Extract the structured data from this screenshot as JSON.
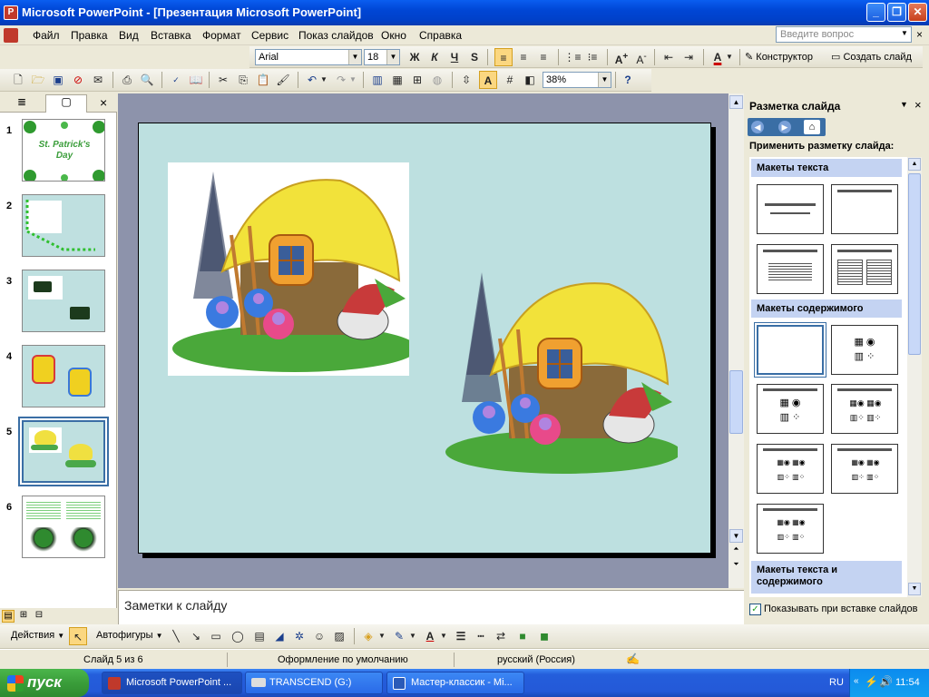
{
  "window": {
    "title": "Microsoft PowerPoint - [Презентация Microsoft PowerPoint]",
    "buttons": [
      "_",
      "❐",
      "✕"
    ]
  },
  "menu": {
    "items": [
      "Файл",
      "Правка",
      "Вид",
      "Вставка",
      "Формат",
      "Сервис",
      "Показ слайдов",
      "Окно",
      "Справка"
    ],
    "help_placeholder": "Введите вопрос"
  },
  "format_toolbar": {
    "font": "Arial",
    "size": "18",
    "bold": "Ж",
    "italic": "К",
    "underline": "Ч",
    "shadow": "S",
    "designer": "Конструктор",
    "new_slide": "Создать слайд"
  },
  "standard_toolbar": {
    "zoom": "38%"
  },
  "slides": {
    "numbers": [
      "1",
      "2",
      "3",
      "4",
      "5",
      "6"
    ],
    "active": "5",
    "thumb1_title": "St. Patrick's Day"
  },
  "notes": {
    "placeholder": "Заметки к слайду"
  },
  "task_pane": {
    "title": "Разметка слайда",
    "apply_label": "Применить разметку слайда:",
    "groups": [
      "Макеты текста",
      "Макеты содержимого",
      "Макеты текста и содержимого"
    ],
    "show_on_insert": "Показывать при вставке слайдов"
  },
  "draw_toolbar": {
    "actions": "Действия",
    "autoshapes": "Автофигуры"
  },
  "status": {
    "slide": "Слайд 5 из 6",
    "design": "Оформление по умолчанию",
    "language": "русский (Россия)"
  },
  "taskbar": {
    "start": "пуск",
    "items": [
      "Microsoft PowerPoint ...",
      "TRANSCEND (G:)",
      "Мастер-классик - Mi..."
    ],
    "lang": "RU",
    "clock": "11:54"
  },
  "colors": {
    "slide_bg": "#bde0e0",
    "title_bar": "#0a5ef0",
    "taskbar": "#245edb",
    "start": "#3a9d3a"
  }
}
